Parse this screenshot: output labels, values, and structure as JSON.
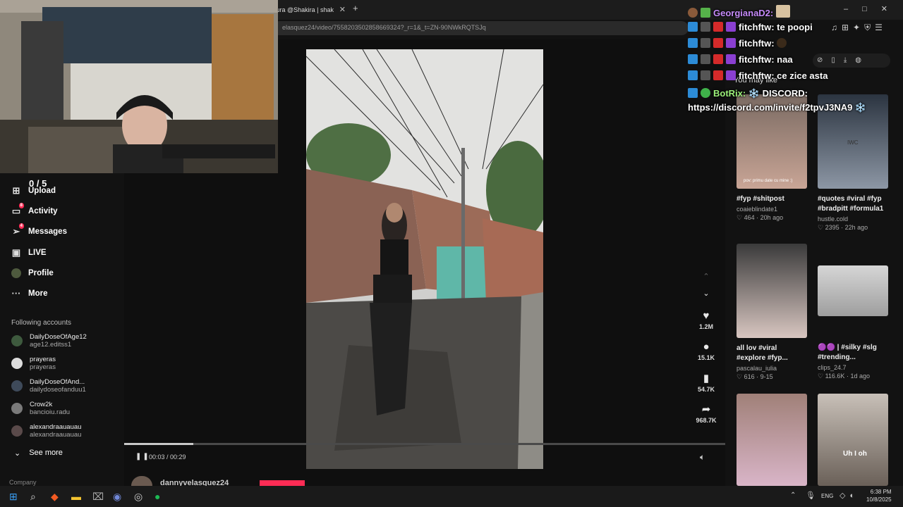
{
  "browser": {
    "tab_title": "rtura @Shakira | shak",
    "url": "elasquez24/video/7558203502858669324?_r=1&_t=ZN-90NWkRQTSJq"
  },
  "stream_counter": "0 / 5",
  "sidebar": {
    "items": [
      {
        "label": "Upload",
        "icon": "upload-icon"
      },
      {
        "label": "Activity",
        "icon": "activity-icon",
        "badge": "8"
      },
      {
        "label": "Messages",
        "icon": "messages-icon",
        "badge": "4"
      },
      {
        "label": "LIVE",
        "icon": "live-icon"
      },
      {
        "label": "Profile",
        "icon": "avatar"
      },
      {
        "label": "More",
        "icon": "more-icon"
      }
    ],
    "following_header": "Following accounts",
    "accounts": [
      {
        "name": "DailyDoseOfAge12",
        "handle": "age12.editss1"
      },
      {
        "name": "prayeras",
        "handle": "prayeras"
      },
      {
        "name": "DailyDoseOfAnd...",
        "handle": "dailydoseofanduu1"
      },
      {
        "name": "Crow2k",
        "handle": "bancioiu.radu"
      },
      {
        "name": "alexandraauauau",
        "handle": "alexandraauauau"
      }
    ],
    "see_more": "See more",
    "company": "Company"
  },
  "player": {
    "time": "00:03 / 00:29",
    "progress": 0.115,
    "author": "dannyvelasquez24"
  },
  "actions": [
    {
      "icon": "heart-icon",
      "count": "1.2M"
    },
    {
      "icon": "comment-icon",
      "count": "15.1K"
    },
    {
      "icon": "bookmark-icon",
      "count": "54.7K"
    },
    {
      "icon": "share-icon",
      "count": "968.7K"
    }
  ],
  "you_may_like": "You may like",
  "recommended": [
    {
      "title": "#fyp #shitpost",
      "user": "coaieblindate1",
      "likes": "464",
      "age": "20h ago",
      "thumb_text": "pov: primu date cu mine :)"
    },
    {
      "title": "#quotes #viral #fyp #bradpitt #formula1",
      "user": "hustle.cold",
      "likes": "2395",
      "age": "22h ago",
      "thumb_text": "IWC"
    },
    {
      "title": "all lov #viral #explore #fyp...",
      "user": "pascalau_iulia",
      "likes": "616",
      "age": "9-15",
      "thumb_text": ""
    },
    {
      "title": "🟣🟣 | #silky #slg #trending...",
      "user": "clips_24.7",
      "likes": "116.6K",
      "age": "1d ago",
      "thumb_text": ""
    },
    {
      "title": "",
      "user": "",
      "likes": "",
      "age": "",
      "thumb_text": ""
    },
    {
      "title": "",
      "user": "",
      "likes": "",
      "age": "",
      "thumb_text": "Uh I oh"
    }
  ],
  "chat": [
    {
      "user": "GeorgianaD2:",
      "msg": "",
      "color": "#c58af9"
    },
    {
      "user": "fitchftw:",
      "msg": "te poopi",
      "color": "#ffffff"
    },
    {
      "user": "fitchftw:",
      "msg": "",
      "color": "#ffffff"
    },
    {
      "user": "fitchftw:",
      "msg": "naa",
      "color": "#ffffff"
    },
    {
      "user": "fitchftw:",
      "msg": "ce zice asta",
      "color": "#ffffff"
    },
    {
      "user": "BotRix:",
      "msg": "❄️ DISCORD:",
      "color": "#9cf07a"
    },
    {
      "user": "",
      "msg": "https://discord.com/invite/f2tpvJ3NA9 ❄️",
      "color": "#ffffff"
    }
  ],
  "taskbar": {
    "lang": "ENG",
    "time": "6:38 PM",
    "date": "10/8/2025"
  },
  "colors": {
    "accent": "#fe2c55",
    "background": "#121212"
  }
}
